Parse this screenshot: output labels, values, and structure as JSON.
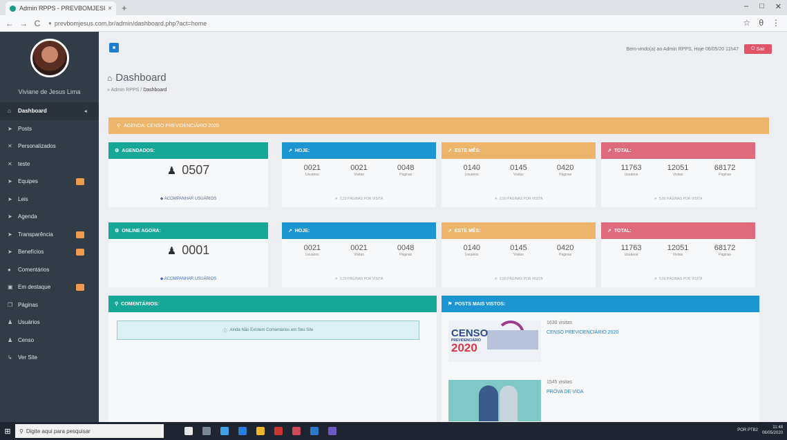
{
  "browser": {
    "tab_title": "Admin RPPS - PREVBOMJESUS",
    "tab_close": "×",
    "new_tab": "+",
    "url": "prevbomjesus.com.br/admin/dashboard.php?act=home",
    "nav_back": "←",
    "nav_forward": "→",
    "nav_reload": "C",
    "star": "☆",
    "profile": "θ",
    "menu": "⋮",
    "win_min": "–",
    "win_max": "□",
    "win_close": "✕"
  },
  "sidebar": {
    "user_name": "Viviane de Jesus Lima",
    "items": [
      {
        "label": "Dashboard",
        "icon": "home-icon",
        "glyph": "⌂"
      },
      {
        "label": "Posts",
        "icon": "pin-icon",
        "glyph": "➤"
      },
      {
        "label": "Personalizados",
        "icon": "pin-icon",
        "glyph": "✕"
      },
      {
        "label": "teste",
        "icon": "pin-icon",
        "glyph": "✕"
      },
      {
        "label": "Equipes",
        "icon": "pin-icon",
        "glyph": "➤"
      },
      {
        "label": "Leis",
        "icon": "pin-icon",
        "glyph": "➤"
      },
      {
        "label": "Agenda",
        "icon": "pin-icon",
        "glyph": "➤"
      },
      {
        "label": "Transparência",
        "icon": "pin-icon",
        "glyph": "➤"
      },
      {
        "label": "Benefícios",
        "icon": "pin-icon",
        "glyph": "➤"
      },
      {
        "label": "Comentários",
        "icon": "comment-icon",
        "glyph": "●"
      },
      {
        "label": "Em destaque",
        "icon": "star-icon",
        "glyph": "▣"
      },
      {
        "label": "Páginas",
        "icon": "page-icon",
        "glyph": "❐"
      },
      {
        "label": "Usuários",
        "icon": "user-icon",
        "glyph": "♟"
      },
      {
        "label": "Censo",
        "icon": "user-icon",
        "glyph": "♟"
      },
      {
        "label": "Ver Site",
        "icon": "link-icon",
        "glyph": "↳"
      }
    ],
    "caret": "◂"
  },
  "topbar": {
    "toggle_glyph": "■",
    "welcome": "Bem-vindo(a) ao Admin RPPS, Hoje 06/05/20 11h47",
    "logout": "Sair",
    "logout_glyph": "⏻"
  },
  "page": {
    "title": "Dashboard",
    "title_glyph": "⌂",
    "crumb_root": "Admin RPPS",
    "crumb_sep": "/",
    "crumb_current": "Dashboard",
    "crumb_prefix": "»"
  },
  "agenda": {
    "label": "AGENDA: CENSO PREVIDENCIÁRIO 2020",
    "glyph": "⚲"
  },
  "agendados": {
    "header": "AGENDADOS:",
    "glyph": "⚙",
    "count": "0507",
    "count_glyph": "♟",
    "link": "ACOMPANHAR USUÁRIOS",
    "link_glyph": "◆"
  },
  "online": {
    "header": "ONLINE AGORA:",
    "glyph": "⚙",
    "count": "0001",
    "count_glyph": "♟",
    "link": "ACOMPANHAR USUÁRIOS",
    "link_glyph": "◆"
  },
  "metrics_row1": [
    {
      "header": "HOJE:",
      "color": "#1d95d3",
      "stats": [
        {
          "n": "0021",
          "l": "Usuários"
        },
        {
          "n": "0021",
          "l": "Visitas"
        },
        {
          "n": "0048",
          "l": "Páginas"
        }
      ],
      "footer": "2,29 PÁGINAS POR VISITA"
    },
    {
      "header": "ESTE MÊS:",
      "color": "#edb56b",
      "stats": [
        {
          "n": "0140",
          "l": "Usuários"
        },
        {
          "n": "0145",
          "l": "Visitas"
        },
        {
          "n": "0420",
          "l": "Páginas"
        }
      ],
      "footer": "2,90 PÁGINAS POR VISITA"
    },
    {
      "header": "TOTAL:",
      "color": "#e06a7d",
      "stats": [
        {
          "n": "11763",
          "l": "Usuários"
        },
        {
          "n": "12051",
          "l": "Visitas"
        },
        {
          "n": "68172",
          "l": "Páginas"
        }
      ],
      "footer": "5,66 PÁGINAS POR VISITA"
    }
  ],
  "metrics_row2": [
    {
      "header": "HOJE:",
      "color": "#1d95d3",
      "stats": [
        {
          "n": "0021",
          "l": "Usuários"
        },
        {
          "n": "0021",
          "l": "Visitas"
        },
        {
          "n": "0048",
          "l": "Páginas"
        }
      ],
      "footer": "2,29 PÁGINAS POR VISITA"
    },
    {
      "header": "ESTE MÊS:",
      "color": "#edb56b",
      "stats": [
        {
          "n": "0140",
          "l": "Usuários"
        },
        {
          "n": "0145",
          "l": "Visitas"
        },
        {
          "n": "0420",
          "l": "Páginas"
        }
      ],
      "footer": "2,90 PÁGINAS POR VISITA"
    },
    {
      "header": "TOTAL:",
      "color": "#e06a7d",
      "stats": [
        {
          "n": "11763",
          "l": "Usuários"
        },
        {
          "n": "12051",
          "l": "Visitas"
        },
        {
          "n": "68172",
          "l": "Páginas"
        }
      ],
      "footer": "5,66 PÁGINAS POR VISITA"
    }
  ],
  "metric_glyph": "↗",
  "metric_footer_glyph": "✕",
  "comments": {
    "header": "COMENTÁRIOS:",
    "glyph": "⚲",
    "empty": "Ainda Não Existem Comentários em Seu Site",
    "empty_glyph": "ⓘ"
  },
  "posts": {
    "header": "POSTS MAIS VISTOS:",
    "glyph": "⚑",
    "items": [
      {
        "views": "1630 visitas",
        "title": "CENSO PREVIDENCIÁRIO 2020",
        "thumb_word": "CENSO",
        "thumb_sub": "PREVIDENCIÁRIO",
        "thumb_year": "2020"
      },
      {
        "views": "1545 visitas",
        "title": "PROVA DE VIDA"
      }
    ]
  },
  "taskbar": {
    "start_glyph": "⊞",
    "search": "Digite aqui para pesquisar",
    "search_glyph": "⚲",
    "tray_lang": "POR PTB2",
    "time": "11:48",
    "date": "06/05/2020",
    "icons": [
      "#e6e6e6",
      "#7a8796",
      "#3fa0e6",
      "#2b7de0",
      "#f0b429",
      "#c9362f",
      "#d24a5a",
      "#2f77c8",
      "#6e58c4"
    ]
  }
}
